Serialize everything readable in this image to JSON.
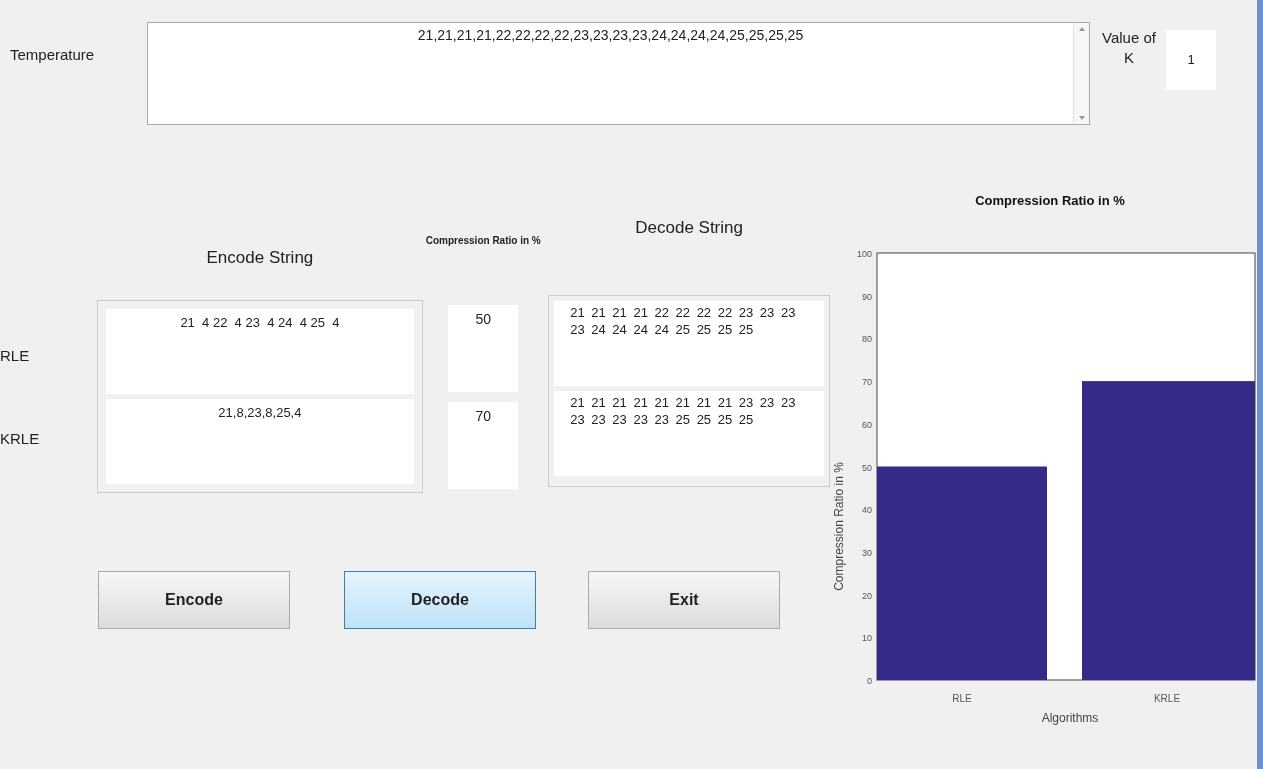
{
  "temperature": {
    "label": "Temperature",
    "value": "21,21,21,21,22,22,22,22,23,23,23,23,24,24,24,24,25,25,25,25"
  },
  "k": {
    "label": "Value of K",
    "value": "1"
  },
  "headers": {
    "encode": "Encode String",
    "ratio": "Compression Ratio in %",
    "decode": "Decode String"
  },
  "rows": [
    {
      "label": "RLE",
      "encoded": "21  4 22  4 23  4 24  4 25  4",
      "ratio": "50",
      "decoded": "21 21 21 21 22 22 22 22 23 23 23 23 24 24 24 24 25 25 25 25"
    },
    {
      "label": "KRLE",
      "encoded": "21,8,23,8,25,4",
      "ratio": "70",
      "decoded": "21 21 21 21 21 21 21 21 23 23 23 23 23 23 23 23 25 25 25 25"
    }
  ],
  "buttons": [
    {
      "label": "Encode",
      "selected": false
    },
    {
      "label": "Decode",
      "selected": true
    },
    {
      "label": "Exit",
      "selected": false
    }
  ],
  "chart": {
    "chart_data": {
      "type": "bar",
      "title": "Compression Ratio in %",
      "xlabel": "Algorithms",
      "ylabel": "Compression Ratio in %",
      "categories": [
        "RLE",
        "KRLE"
      ],
      "series": [
        {
          "color": "#352a87",
          "values": [
            50,
            70
          ]
        }
      ],
      "ylim": [
        0,
        100
      ],
      "yticks": [
        0,
        10,
        20,
        30,
        40,
        50,
        60,
        70,
        80,
        90,
        100
      ]
    }
  }
}
